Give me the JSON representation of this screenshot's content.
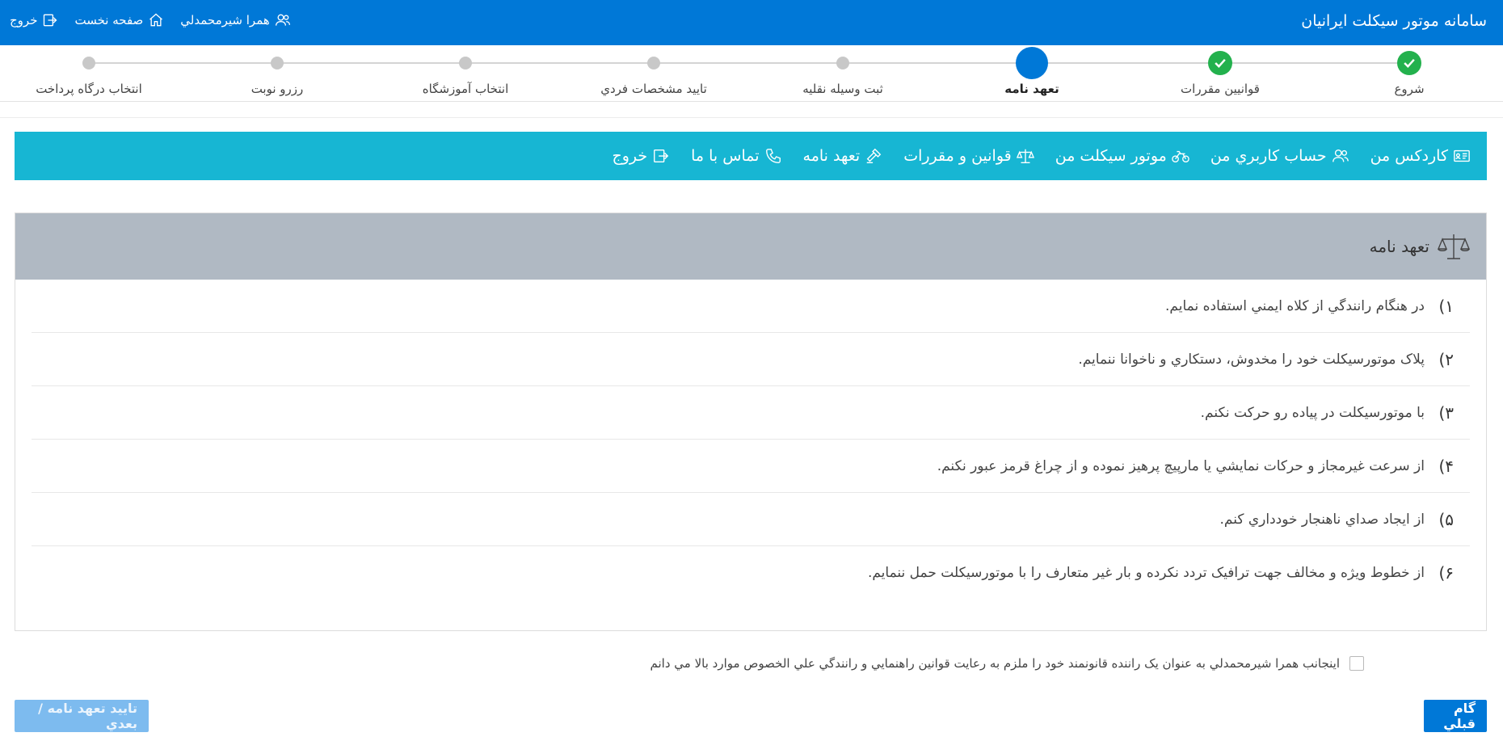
{
  "app_title": "سامانه موتور سيكلت ايرانيان",
  "user": {
    "name": "همرا شيرمحمدلي",
    "home_label": "صفحه نخست",
    "logout_label": "خروج"
  },
  "steps": [
    {
      "label": "شروع",
      "state": "done"
    },
    {
      "label": "قوانيين مقررات",
      "state": "done"
    },
    {
      "label": "تعهد نامه",
      "state": "active"
    },
    {
      "label": "ثبت وسيله نقليه",
      "state": "pending"
    },
    {
      "label": "تاييد مشخصات فردي",
      "state": "pending"
    },
    {
      "label": "انتخاب آموزشگاه",
      "state": "pending"
    },
    {
      "label": "رزرو نوبت",
      "state": "pending"
    },
    {
      "label": "انتخاب درگاه پرداخت",
      "state": "pending"
    }
  ],
  "nav": {
    "kardex": "كاردكس من",
    "account": "حساب كاربري من",
    "motorcycle": "موتور سيكلت من",
    "rules": "قوانين و مقررات",
    "pledge": "تعهد نامه",
    "contact": "تماس با ما",
    "logout": "خروج"
  },
  "panel": {
    "title": "تعهد نامه",
    "terms": [
      {
        "num": "١)",
        "text": "در هنگام رانندگي از كلاه ايمني استفاده نمايم."
      },
      {
        "num": "٢)",
        "text": "پلاک موتورسيكلت خود را مخدوش، دستكاري و ناخوانا ننمايم."
      },
      {
        "num": "٣)",
        "text": "با موتورسيكلت در پياده رو حركت نكنم."
      },
      {
        "num": "۴)",
        "text": "از سرعت غيرمجاز و حركات نمايشي يا مارپيچ پرهيز نموده و از چراغ قرمز عبور نكنم."
      },
      {
        "num": "۵)",
        "text": "از ايجاد صداي ناهنجار خودداري كنم."
      },
      {
        "num": "۶)",
        "text": "از خطوط ويژه و مخالف جهت ترافيک تردد نكرده و بار غير متعارف را با موتورسيكلت حمل ننمايم."
      }
    ]
  },
  "agreement_text": "اينجانب همرا شيرمحمدلي به عنوان يک راننده قانونمند خود را ملزم به رعايت قوانين راهنمايي و رانندگي علي الخصوص موارد بالا مي دانم",
  "buttons": {
    "prev": "گام قبلي",
    "next": "تاييد تعهد نامه / بعدي"
  },
  "colors": {
    "primary": "#0078d7",
    "nav": "#17b6d3",
    "done": "#23b14d",
    "panel_head": "#b0b9c3"
  }
}
